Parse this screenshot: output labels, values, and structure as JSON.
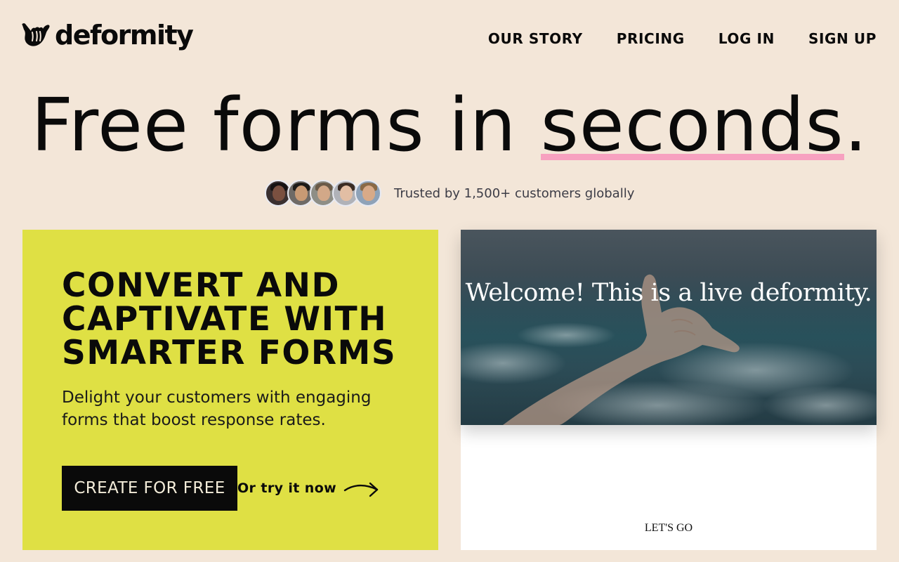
{
  "brand": {
    "name": "deformity",
    "logo_icon": "shaka-hand-icon"
  },
  "nav": {
    "items": [
      {
        "label": "OUR STORY"
      },
      {
        "label": "PRICING"
      },
      {
        "label": "LOG IN"
      },
      {
        "label": "SIGN UP"
      }
    ]
  },
  "hero": {
    "title_before": "Free forms in ",
    "title_highlight": "seconds",
    "title_after": ".",
    "highlight_color": "#f7a1c0"
  },
  "trust": {
    "text": "Trusted by 1,500+ customers globally",
    "avatar_count": 5
  },
  "promo": {
    "heading": "CONVERT AND CAPTIVATE WITH SMARTER FORMS",
    "subtext": "Delight your customers with engaging forms that boost response rates.",
    "cta_label": "CREATE FOR FREE",
    "try_label": "Or try it now",
    "background_color": "#dfe044"
  },
  "demo": {
    "welcome_text": "Welcome! This is a live deformity.",
    "button_label": "LET'S GO"
  },
  "colors": {
    "page_background": "#f3e6d8",
    "cta_background": "#0a0a0a",
    "text": "#0a0a0a"
  }
}
